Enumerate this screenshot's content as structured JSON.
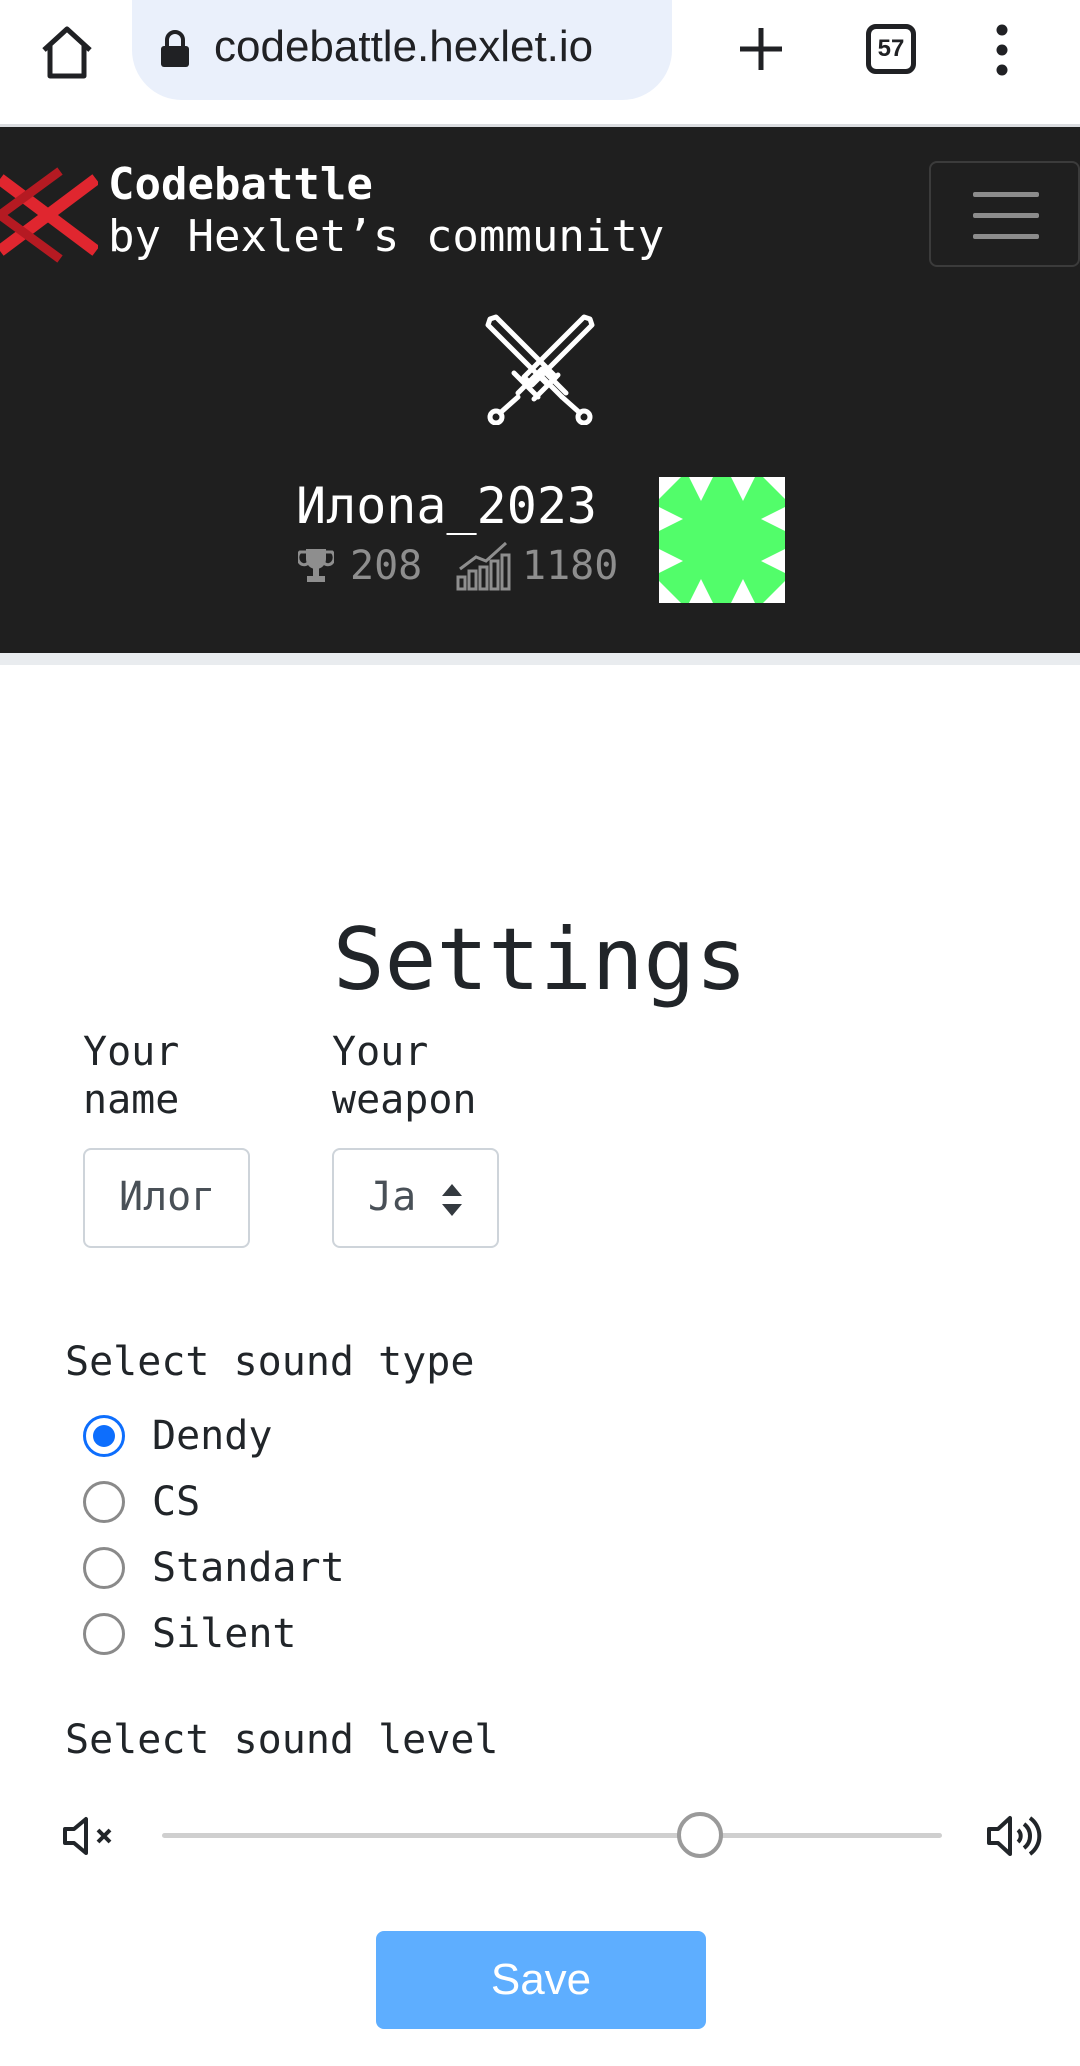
{
  "browser": {
    "url": "codebattle.hexlet.io",
    "tab_count": "57",
    "home_icon": "home-icon",
    "lock_icon": "lock-icon",
    "new_tab_icon": "plus-icon",
    "menu_icon": "kebab-menu-icon"
  },
  "navbar": {
    "brand_title": "Codebattle",
    "brand_subtitle": "by Hexlet’s community",
    "logo_color": "#e0262f",
    "menu_icon": "hamburger-icon",
    "user": {
      "name": "Илona_2023",
      "rank": "208",
      "rating": "1180",
      "avatar_color": "#52fd6a"
    }
  },
  "settings": {
    "title": "Settings",
    "name_label": "Your name",
    "name_value": "Илог",
    "weapon_label": "Your weapon",
    "weapon_value": "Ja",
    "sound_type_label": "Select sound type",
    "sound_types": [
      {
        "label": "Dendy",
        "checked": true
      },
      {
        "label": "CS",
        "checked": false
      },
      {
        "label": "Standart",
        "checked": false
      },
      {
        "label": "Silent",
        "checked": false
      }
    ],
    "sound_level_label": "Select sound level",
    "sound_level": 0.69,
    "save_label": "Save",
    "accent": "#0d6efd",
    "save_color": "#5eaeff"
  }
}
